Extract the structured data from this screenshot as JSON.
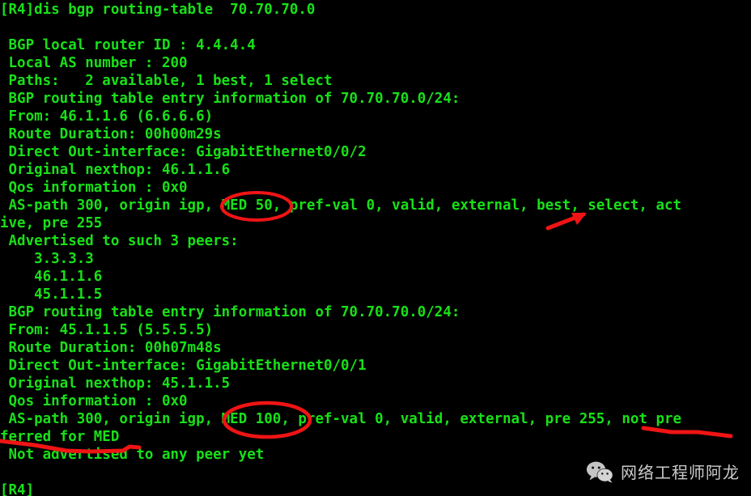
{
  "terminal": {
    "title": "BGP routing-table output",
    "foreground_color": "#18e018",
    "background_color": "#000000",
    "prompt": "[R4]",
    "command": "dis bgp routing-table  70.70.70.0",
    "lines": [
      "[R4]dis bgp routing-table  70.70.70.0",
      "",
      " BGP local router ID : 4.4.4.4",
      " Local AS number : 200",
      " Paths:   2 available, 1 best, 1 select",
      " BGP routing table entry information of 70.70.70.0/24:",
      " From: 46.1.1.6 (6.6.6.6)",
      " Route Duration: 00h00m29s",
      " Direct Out-interface: GigabitEthernet0/0/2",
      " Original nexthop: 46.1.1.6",
      " Qos information : 0x0",
      " AS-path 300, origin igp, MED 50, pref-val 0, valid, external, best, select, act",
      "ive, pre 255",
      " Advertised to such 3 peers:",
      "    3.3.3.3",
      "    46.1.1.6",
      "    45.1.1.5",
      " BGP routing table entry information of 70.70.70.0/24:",
      " From: 45.1.1.5 (5.5.5.5)",
      " Route Duration: 00h07m48s",
      " Direct Out-interface: GigabitEthernet0/0/1",
      " Original nexthop: 45.1.1.5",
      " Qos information : 0x0",
      " AS-path 300, origin igp, MED 100, pref-val 0, valid, external, pre 255, not pre",
      "ferred for MED",
      " Not advertised to any peer yet",
      "",
      "[R4]"
    ],
    "bgp": {
      "local_router_id": "4.4.4.4",
      "local_as_number": "200",
      "paths_summary": "2 available, 1 best, 1 select",
      "prefix": "70.70.70.0/24",
      "entries": [
        {
          "from": "46.1.1.6",
          "router_id": "6.6.6.6",
          "route_duration": "00h00m29s",
          "out_interface": "GigabitEthernet0/0/2",
          "original_nexthop": "46.1.1.6",
          "qos_information": "0x0",
          "as_path": "300",
          "origin": "igp",
          "med": "50",
          "pref_val": "0",
          "flags": "valid, external, best, select, active",
          "pre": "255",
          "advertised_peers_count": "3",
          "advertised_peers": [
            "3.3.3.3",
            "46.1.1.6",
            "45.1.1.5"
          ]
        },
        {
          "from": "45.1.1.5",
          "router_id": "5.5.5.5",
          "route_duration": "00h07m48s",
          "out_interface": "GigabitEthernet0/0/1",
          "original_nexthop": "45.1.1.5",
          "qos_information": "0x0",
          "as_path": "300",
          "origin": "igp",
          "med": "100",
          "pref_val": "0",
          "flags": "valid, external",
          "pre": "255",
          "not_preferred_reason": "not preferred for MED",
          "advertised_status": "Not advertised to any peer yet"
        }
      ]
    }
  },
  "annotations": {
    "color": "#f01414",
    "items": [
      {
        "name": "ellipse-med-50",
        "label": "MED 50",
        "shape": "ellipse"
      },
      {
        "name": "ellipse-med-100",
        "label": "MED 100,",
        "shape": "ellipse"
      },
      {
        "name": "arrow-best",
        "label": "best",
        "shape": "arrow"
      },
      {
        "name": "underline-not-preferred",
        "label": "not pre",
        "shape": "underline"
      },
      {
        "name": "underline-ferred-for-med",
        "label": "ferred for MED",
        "shape": "underline"
      }
    ]
  },
  "watermark": {
    "icon": "wechat-icon",
    "text": "网络工程师阿龙",
    "text_color": "#e8e8e8"
  }
}
